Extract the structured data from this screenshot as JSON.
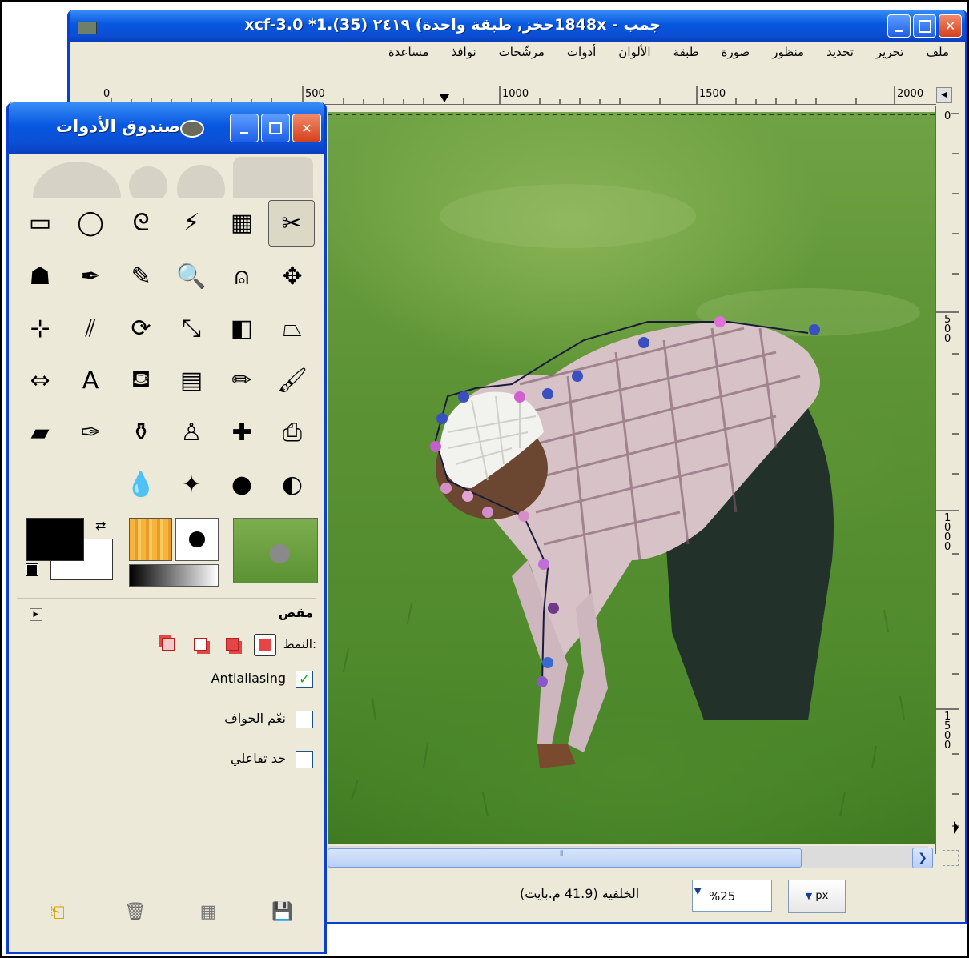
{
  "main_window": {
    "title": "جمب - 1848x2419 حخز, طبقة واحدة) ٢٤١٩ 1 (35).xcf-3.0 *1",
    "title_display": "جمب - 1848xحخز, طبقة واحدة) ٢٤١٩ (35).xcf-3.0 *1",
    "menu": [
      "ملف",
      "تحرير",
      "تحديد",
      "منظور",
      "صورة",
      "طبقة",
      "الألوان",
      "أدوات",
      "مرشّحات",
      "نوافذ",
      "مساعدة"
    ],
    "ruler_labels": [
      "0",
      "500",
      "1000",
      "1500",
      "2000"
    ],
    "vruler_labels": [
      "0",
      "500",
      "1000",
      "1500"
    ],
    "status_text": "الخلفية (41.9 م.بايت)",
    "zoom_value": "%25",
    "unit_value": "px"
  },
  "toolbox": {
    "title": "صندوق الأدوات",
    "tool_options_title": "مقص",
    "mode_label": "النمط:",
    "antialiasing_label": "Antialiasing",
    "antialiasing_checked": "✓",
    "feather_label": "نعّم الحواف",
    "interactive_label": "حد تفاعلي",
    "tools": [
      {
        "name": "scissors-select-icon",
        "glyph": "✂"
      },
      {
        "name": "select-by-color-icon",
        "glyph": "▦"
      },
      {
        "name": "fuzzy-select-icon",
        "glyph": "⚡"
      },
      {
        "name": "free-select-icon",
        "glyph": "ᘓ"
      },
      {
        "name": "ellipse-select-icon",
        "glyph": "◯"
      },
      {
        "name": "rect-select-icon",
        "glyph": "▭"
      },
      {
        "name": "move-icon",
        "glyph": "✥"
      },
      {
        "name": "measure-icon",
        "glyph": "⍝"
      },
      {
        "name": "zoom-icon",
        "glyph": "🔍"
      },
      {
        "name": "color-picker-icon",
        "glyph": "✎"
      },
      {
        "name": "paths-icon",
        "glyph": "✒"
      },
      {
        "name": "foreground-select-icon",
        "glyph": "☗"
      },
      {
        "name": "perspective-icon",
        "glyph": "⏢"
      },
      {
        "name": "flip-icon",
        "glyph": "◧"
      },
      {
        "name": "scale-icon",
        "glyph": "⤡"
      },
      {
        "name": "rotate-icon",
        "glyph": "⟳"
      },
      {
        "name": "shear-icon",
        "glyph": "⫽"
      },
      {
        "name": "align-icon",
        "glyph": "⊹"
      },
      {
        "name": "paintbrush-icon",
        "glyph": "🖌"
      },
      {
        "name": "pencil-icon",
        "glyph": "✏"
      },
      {
        "name": "blend-icon",
        "glyph": "▤"
      },
      {
        "name": "bucket-fill-icon",
        "glyph": "⛾"
      },
      {
        "name": "text-icon",
        "glyph": "A"
      },
      {
        "name": "flip-tool-icon",
        "glyph": "⇔"
      },
      {
        "name": "perspective-clone-icon",
        "glyph": "⎙"
      },
      {
        "name": "heal-icon",
        "glyph": "✚"
      },
      {
        "name": "clone-icon",
        "glyph": "♙"
      },
      {
        "name": "ink-icon",
        "glyph": "⚱"
      },
      {
        "name": "airbrush-icon",
        "glyph": "✑"
      },
      {
        "name": "eraser-icon",
        "glyph": "▰"
      },
      {
        "name": "dodge-burn-icon",
        "glyph": "◐"
      },
      {
        "name": "smudge-icon",
        "glyph": "●"
      },
      {
        "name": "sharpen-icon",
        "glyph": "✦"
      },
      {
        "name": "blur-icon",
        "glyph": "💧"
      },
      {
        "name": "dummy-1",
        "glyph": ""
      },
      {
        "name": "dummy-2",
        "glyph": ""
      }
    ]
  },
  "colors": {
    "title_bar": "#0857e0",
    "window_border": "#0a3fd1",
    "window_bg": "#ece9d8",
    "foreground": "#000000",
    "background": "#ffffff",
    "close_button": "#d6401c"
  }
}
